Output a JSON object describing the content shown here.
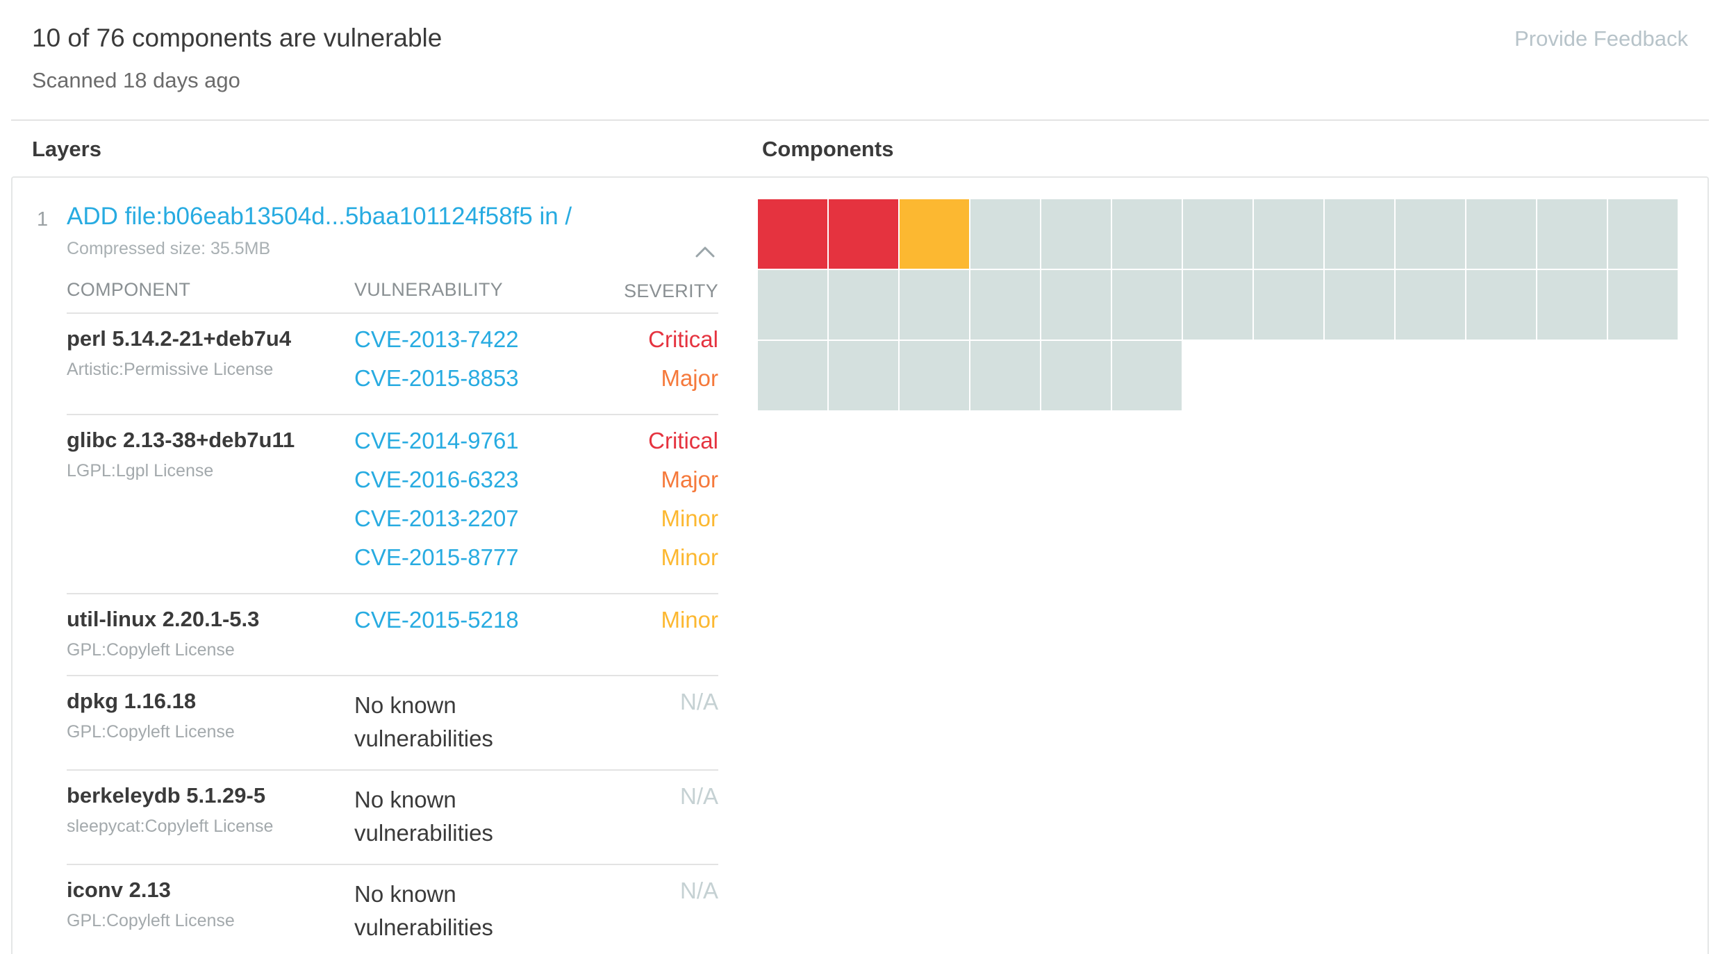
{
  "header": {
    "summary": "10 of 76 components are vulnerable",
    "scanned": "Scanned 18 days ago",
    "feedback_label": "Provide Feedback"
  },
  "sections": {
    "layers_heading": "Layers",
    "components_heading": "Components"
  },
  "layer": {
    "index": "1",
    "command": "ADD file:b06eab13504d...5baa101124f58f5 in /",
    "compressed_size": "Compressed size: 35.5MB",
    "collapse_icon": "chevron-up-icon"
  },
  "table": {
    "headers": {
      "component": "COMPONENT",
      "vulnerability": "VULNERABILITY",
      "severity": "SEVERITY"
    },
    "rows": [
      {
        "name": "perl 5.14.2-21+deb7u4",
        "license": "Artistic:Permissive License",
        "vulns": [
          {
            "id": "CVE-2013-7422",
            "severity": "Critical"
          },
          {
            "id": "CVE-2015-8853",
            "severity": "Major"
          }
        ]
      },
      {
        "name": "glibc 2.13-38+deb7u11",
        "license": "LGPL:Lgpl License",
        "vulns": [
          {
            "id": "CVE-2014-9761",
            "severity": "Critical"
          },
          {
            "id": "CVE-2016-6323",
            "severity": "Major"
          },
          {
            "id": "CVE-2013-2207",
            "severity": "Minor"
          },
          {
            "id": "CVE-2015-8777",
            "severity": "Minor"
          }
        ]
      },
      {
        "name": "util-linux 2.20.1-5.3",
        "license": "GPL:Copyleft License",
        "vulns": [
          {
            "id": "CVE-2015-5218",
            "severity": "Minor"
          }
        ]
      },
      {
        "name": "dpkg 1.16.18",
        "license": "GPL:Copyleft License",
        "vulns": [],
        "no_vuln_text": "No known vulnerabilities",
        "severity_na": "N/A"
      },
      {
        "name": "berkeleydb 5.1.29-5",
        "license": "sleepycat:Copyleft License",
        "vulns": [],
        "no_vuln_text": "No known vulnerabilities",
        "severity_na": "N/A"
      },
      {
        "name": "iconv 2.13",
        "license": "GPL:Copyleft License",
        "vulns": [],
        "no_vuln_text": "No known vulnerabilities",
        "severity_na": "N/A"
      }
    ]
  },
  "severity_colors": {
    "Critical": "#e5333f",
    "Major": "#f5793b",
    "Minor": "#fcb831",
    "None": "#d4e0de"
  },
  "component_grid": {
    "columns": 13,
    "cells": [
      "Critical",
      "Critical",
      "Minor",
      "None",
      "None",
      "None",
      "None",
      "None",
      "None",
      "None",
      "None",
      "None",
      "None",
      "None",
      "None",
      "None",
      "None",
      "None",
      "None",
      "None",
      "None",
      "None",
      "None",
      "None",
      "None",
      "None",
      "None",
      "None",
      "None",
      "None",
      "None",
      "None"
    ]
  }
}
